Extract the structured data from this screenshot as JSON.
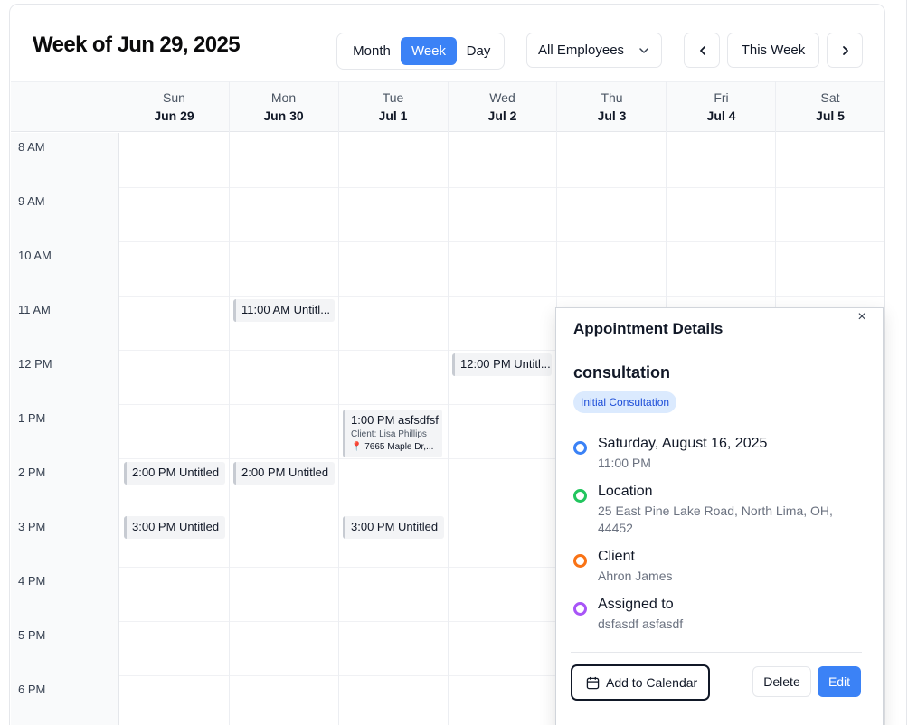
{
  "header": {
    "title": "Week of Jun 29, 2025",
    "views": {
      "month": "Month",
      "week": "Week",
      "day": "Day",
      "active": "Week"
    },
    "employee_filter": "All Employees",
    "today_label": "This Week",
    "icons": {
      "prev": "chevron-left-icon",
      "next": "chevron-right-icon",
      "dropdown": "chevron-down-icon"
    }
  },
  "days": [
    {
      "dow": "Sun",
      "date": "Jun 29"
    },
    {
      "dow": "Mon",
      "date": "Jun 30"
    },
    {
      "dow": "Tue",
      "date": "Jul 1"
    },
    {
      "dow": "Wed",
      "date": "Jul 2"
    },
    {
      "dow": "Thu",
      "date": "Jul 3"
    },
    {
      "dow": "Fri",
      "date": "Jul 4"
    },
    {
      "dow": "Sat",
      "date": "Jul 5"
    }
  ],
  "times": [
    "8 AM",
    "9 AM",
    "10 AM",
    "11 AM",
    "12 PM",
    "1 PM",
    "2 PM",
    "3 PM",
    "4 PM",
    "5 PM",
    "6 PM"
  ],
  "events": {
    "mon_11": "11:00 AM Untitl...",
    "wed_12": "12:00 PM Untitl...",
    "tue_13": {
      "title": "1:00 PM asfsdfsf",
      "client": "Client: Lisa Phillips",
      "location": "7665 Maple Dr,..."
    },
    "sun_14": "2:00 PM Untitled",
    "mon_14": "2:00 PM Untitled",
    "sun_15": "3:00 PM Untitled",
    "tue_15": "3:00 PM Untitled"
  },
  "details": {
    "heading": "Appointment Details",
    "close": "×",
    "title": "consultation",
    "badge": "Initial Consultation",
    "date": "Saturday, August 16, 2025",
    "time": "11:00 PM",
    "location_label": "Location",
    "location": "25 East Pine Lake Road, North Lima, OH, 44452",
    "client_label": "Client",
    "client": "Ahron James",
    "assigned_label": "Assigned to",
    "assigned": "dsfasdf asfasdf",
    "add_to_calendar": "Add to Calendar",
    "delete": "Delete",
    "edit": "Edit",
    "colors": {
      "date": "#3b82f6",
      "location": "#22c55e",
      "client": "#f97316",
      "assigned": "#a855f7"
    }
  }
}
